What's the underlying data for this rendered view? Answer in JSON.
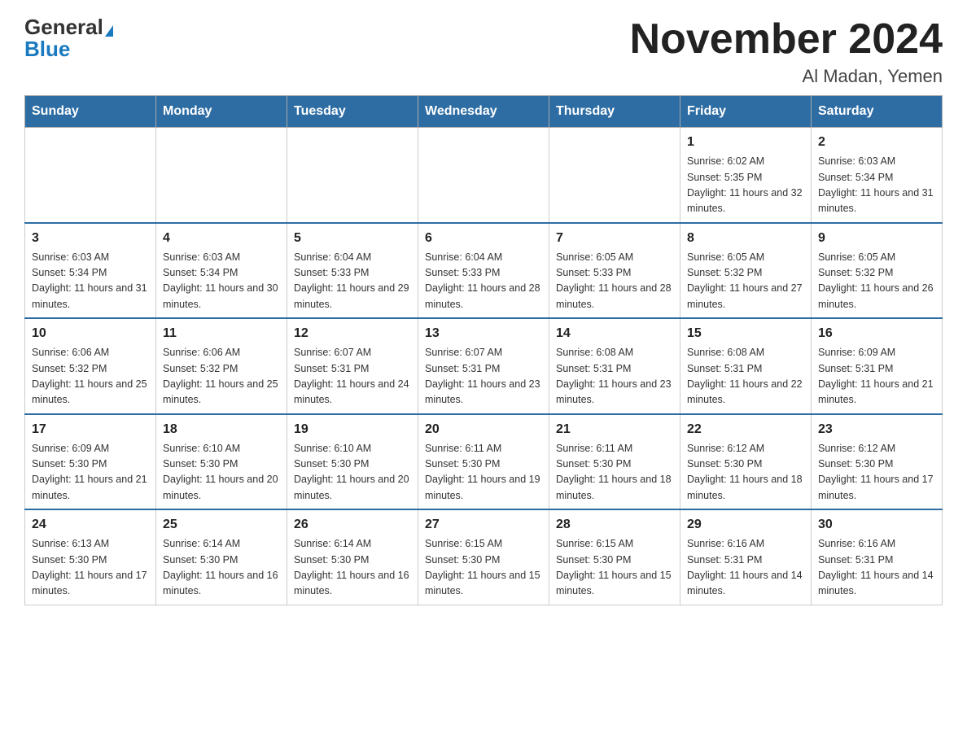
{
  "header": {
    "logo_general": "General",
    "logo_blue": "Blue",
    "month_title": "November 2024",
    "location": "Al Madan, Yemen"
  },
  "days_of_week": [
    "Sunday",
    "Monday",
    "Tuesday",
    "Wednesday",
    "Thursday",
    "Friday",
    "Saturday"
  ],
  "weeks": [
    [
      {
        "day": "",
        "info": ""
      },
      {
        "day": "",
        "info": ""
      },
      {
        "day": "",
        "info": ""
      },
      {
        "day": "",
        "info": ""
      },
      {
        "day": "",
        "info": ""
      },
      {
        "day": "1",
        "info": "Sunrise: 6:02 AM\nSunset: 5:35 PM\nDaylight: 11 hours and 32 minutes."
      },
      {
        "day": "2",
        "info": "Sunrise: 6:03 AM\nSunset: 5:34 PM\nDaylight: 11 hours and 31 minutes."
      }
    ],
    [
      {
        "day": "3",
        "info": "Sunrise: 6:03 AM\nSunset: 5:34 PM\nDaylight: 11 hours and 31 minutes."
      },
      {
        "day": "4",
        "info": "Sunrise: 6:03 AM\nSunset: 5:34 PM\nDaylight: 11 hours and 30 minutes."
      },
      {
        "day": "5",
        "info": "Sunrise: 6:04 AM\nSunset: 5:33 PM\nDaylight: 11 hours and 29 minutes."
      },
      {
        "day": "6",
        "info": "Sunrise: 6:04 AM\nSunset: 5:33 PM\nDaylight: 11 hours and 28 minutes."
      },
      {
        "day": "7",
        "info": "Sunrise: 6:05 AM\nSunset: 5:33 PM\nDaylight: 11 hours and 28 minutes."
      },
      {
        "day": "8",
        "info": "Sunrise: 6:05 AM\nSunset: 5:32 PM\nDaylight: 11 hours and 27 minutes."
      },
      {
        "day": "9",
        "info": "Sunrise: 6:05 AM\nSunset: 5:32 PM\nDaylight: 11 hours and 26 minutes."
      }
    ],
    [
      {
        "day": "10",
        "info": "Sunrise: 6:06 AM\nSunset: 5:32 PM\nDaylight: 11 hours and 25 minutes."
      },
      {
        "day": "11",
        "info": "Sunrise: 6:06 AM\nSunset: 5:32 PM\nDaylight: 11 hours and 25 minutes."
      },
      {
        "day": "12",
        "info": "Sunrise: 6:07 AM\nSunset: 5:31 PM\nDaylight: 11 hours and 24 minutes."
      },
      {
        "day": "13",
        "info": "Sunrise: 6:07 AM\nSunset: 5:31 PM\nDaylight: 11 hours and 23 minutes."
      },
      {
        "day": "14",
        "info": "Sunrise: 6:08 AM\nSunset: 5:31 PM\nDaylight: 11 hours and 23 minutes."
      },
      {
        "day": "15",
        "info": "Sunrise: 6:08 AM\nSunset: 5:31 PM\nDaylight: 11 hours and 22 minutes."
      },
      {
        "day": "16",
        "info": "Sunrise: 6:09 AM\nSunset: 5:31 PM\nDaylight: 11 hours and 21 minutes."
      }
    ],
    [
      {
        "day": "17",
        "info": "Sunrise: 6:09 AM\nSunset: 5:30 PM\nDaylight: 11 hours and 21 minutes."
      },
      {
        "day": "18",
        "info": "Sunrise: 6:10 AM\nSunset: 5:30 PM\nDaylight: 11 hours and 20 minutes."
      },
      {
        "day": "19",
        "info": "Sunrise: 6:10 AM\nSunset: 5:30 PM\nDaylight: 11 hours and 20 minutes."
      },
      {
        "day": "20",
        "info": "Sunrise: 6:11 AM\nSunset: 5:30 PM\nDaylight: 11 hours and 19 minutes."
      },
      {
        "day": "21",
        "info": "Sunrise: 6:11 AM\nSunset: 5:30 PM\nDaylight: 11 hours and 18 minutes."
      },
      {
        "day": "22",
        "info": "Sunrise: 6:12 AM\nSunset: 5:30 PM\nDaylight: 11 hours and 18 minutes."
      },
      {
        "day": "23",
        "info": "Sunrise: 6:12 AM\nSunset: 5:30 PM\nDaylight: 11 hours and 17 minutes."
      }
    ],
    [
      {
        "day": "24",
        "info": "Sunrise: 6:13 AM\nSunset: 5:30 PM\nDaylight: 11 hours and 17 minutes."
      },
      {
        "day": "25",
        "info": "Sunrise: 6:14 AM\nSunset: 5:30 PM\nDaylight: 11 hours and 16 minutes."
      },
      {
        "day": "26",
        "info": "Sunrise: 6:14 AM\nSunset: 5:30 PM\nDaylight: 11 hours and 16 minutes."
      },
      {
        "day": "27",
        "info": "Sunrise: 6:15 AM\nSunset: 5:30 PM\nDaylight: 11 hours and 15 minutes."
      },
      {
        "day": "28",
        "info": "Sunrise: 6:15 AM\nSunset: 5:30 PM\nDaylight: 11 hours and 15 minutes."
      },
      {
        "day": "29",
        "info": "Sunrise: 6:16 AM\nSunset: 5:31 PM\nDaylight: 11 hours and 14 minutes."
      },
      {
        "day": "30",
        "info": "Sunrise: 6:16 AM\nSunset: 5:31 PM\nDaylight: 11 hours and 14 minutes."
      }
    ]
  ]
}
